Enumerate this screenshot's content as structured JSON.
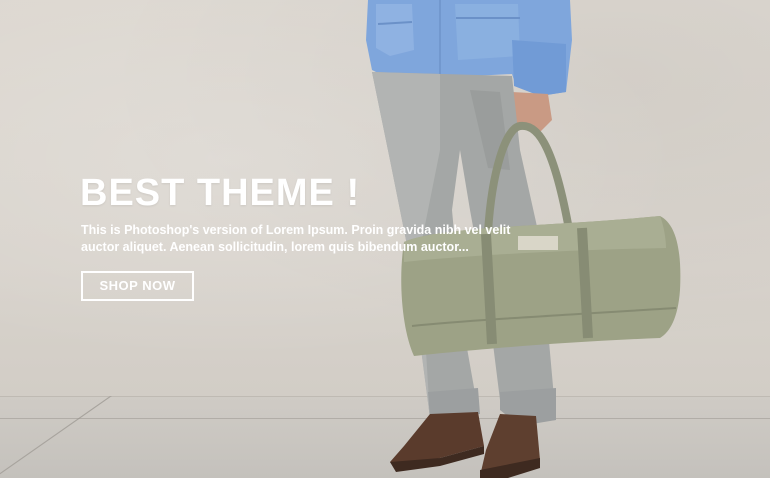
{
  "hero": {
    "title": "BEST THEME !",
    "text": "This is Photoshop's version  of Lorem Ipsum. Proin gravida nibh vel velit auctor aliquet. Aenean sollicitudin, lorem quis bibendum auctor...",
    "button_label": "SHOP NOW"
  },
  "colors": {
    "text": "#ffffff",
    "wall": "#d8d3cc",
    "shirt": "#7fa6dc",
    "trousers": "#a4a7a6",
    "bag": "#9da286",
    "shoes": "#5a3b2c"
  }
}
